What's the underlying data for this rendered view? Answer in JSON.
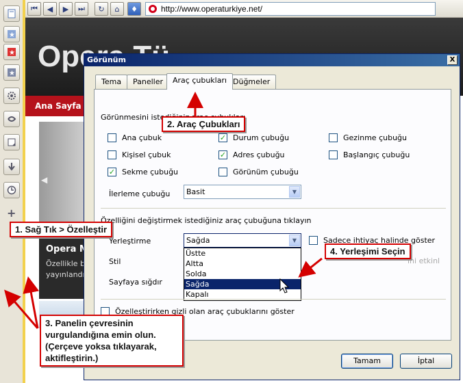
{
  "browser": {
    "url": "http://www.operaturkiye.net/",
    "toolbar_icons": [
      "back-start-icon",
      "back-icon",
      "forward-icon",
      "forward-end-icon",
      "reload-icon",
      "home-icon",
      "wand-icon"
    ]
  },
  "page": {
    "logo": "Opera Tü",
    "nav_home": "Ana Sayfa",
    "promo_title": "Opera M",
    "promo_line1": "Özellikle b",
    "promo_line2": "yayınlandı"
  },
  "panel": {
    "icons": [
      "notes-icon",
      "bookmarks-icon",
      "feeds-icon",
      "bookmarks-alt-icon",
      "settings-gear-icon",
      "widgets-icon",
      "notes-panel-icon",
      "downloads-icon",
      "history-icon",
      "add-icon"
    ]
  },
  "dialog": {
    "title": "Görünüm",
    "close": "X",
    "tabs": [
      "Tema",
      "Paneller",
      "Araç çubukları",
      "Düğmeler"
    ],
    "active_tab": 2,
    "section1_label": "Görünmesini istediğiniz araç çubukları",
    "checkboxes": [
      {
        "label": "Ana çubuk",
        "checked": false
      },
      {
        "label": "Durum çubuğu",
        "checked": true
      },
      {
        "label": "Gezinme çubuğu",
        "checked": false
      },
      {
        "label": "Kişisel çubuk",
        "checked": false
      },
      {
        "label": "Adres çubuğu",
        "checked": true
      },
      {
        "label": "Başlangıç çubuğu",
        "checked": false
      },
      {
        "label": "Sekme çubuğu",
        "checked": true
      },
      {
        "label": "Görünüm çubuğu",
        "checked": false
      }
    ],
    "progress_label": "İlerleme çubuğu",
    "progress_value": "Basit",
    "section2_label": "Özelliğini değiştirmek istediğiniz araç çubuğuna tıklayın",
    "placement_label": "Yerleştirme",
    "placement_value": "Sağda",
    "style_label": "Stil",
    "fit_label": "Sayfaya sığdır",
    "only_when_needed": "Sadece ihtiyaç halinde göster",
    "partial_right": "ini etkinl",
    "placement_options": [
      "Üstte",
      "Altta",
      "Solda",
      "Sağda",
      "Kapalı"
    ],
    "selected_option": 3,
    "show_hidden": "Özelleştirirken gizli olan araç çubuklarını göster",
    "ok": "Tamam",
    "cancel": "İptal"
  },
  "annotations": {
    "step1": "1. Sağ Tık > Özelleştir",
    "step2": "2. Araç Çubukları",
    "step3_line1": "3. Panelin çevresinin",
    "step3_line2": "vurgulandığına emin olun.",
    "step3_line3": "(Çerçeve yoksa tıklayarak,",
    "step3_line4": "aktifleştirin.)",
    "step4": "4. Yerleşimi Seçin",
    "color": "#d40000"
  }
}
